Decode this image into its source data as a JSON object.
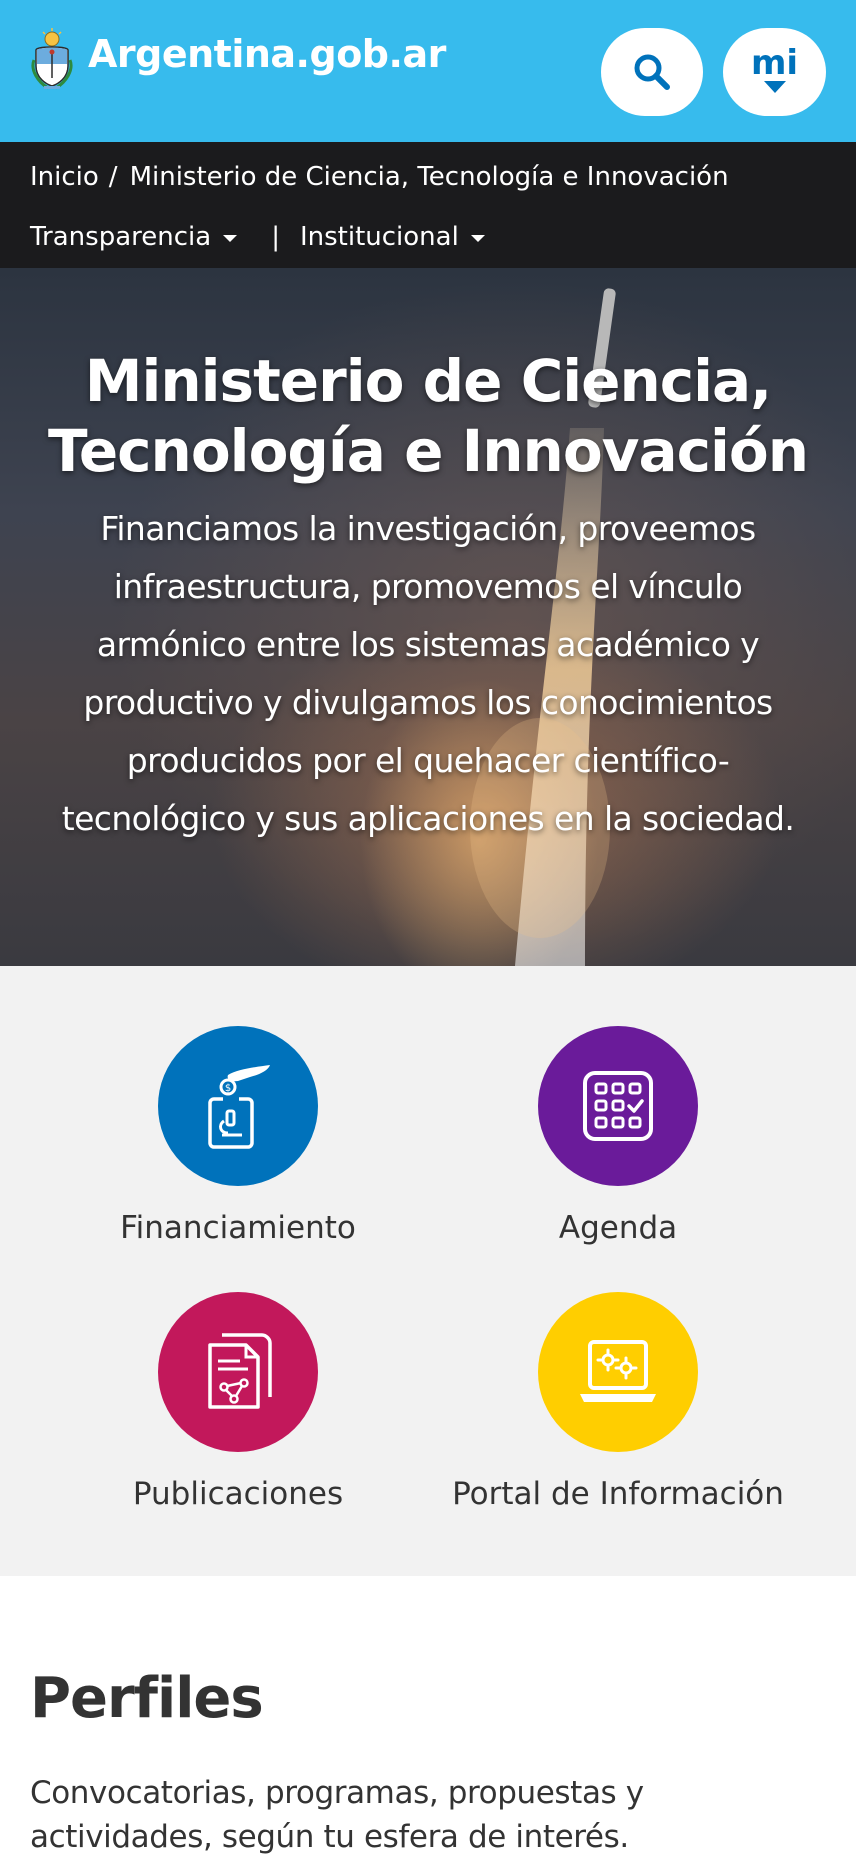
{
  "header": {
    "brand_text": "Argentina.gob.ar",
    "search_icon": "search-icon",
    "mi_label": "mi",
    "colors": {
      "bar": "#37bbed",
      "accent": "#0072bb"
    }
  },
  "breadcrumb": {
    "home": "Inicio",
    "separator": "/",
    "current": "Ministerio de Ciencia, Tecnología e Innovación"
  },
  "menus": {
    "transparencia": "Transparencia",
    "divider": "|",
    "institucional": "Institucional"
  },
  "hero": {
    "title_line1": "Ministerio de Ciencia,",
    "title_line2": "Tecnología e Innovación",
    "description": "Financiamos la investigación, proveemos infraestructura, promovemos el vínculo armónico entre los sistemas académico y productivo y divulgamos los conocimientos producidos por el quehacer científico-tecnológico y sus aplicaciones en la sociedad."
  },
  "quick_links": [
    {
      "label": "Financiamiento",
      "icon": "funding-microscope-icon",
      "color": "#0072bb"
    },
    {
      "label": "Agenda",
      "icon": "calendar-grid-icon",
      "color": "#6a1b9a"
    },
    {
      "label": "Publicaciones",
      "icon": "publications-document-icon",
      "color": "#c2185b"
    },
    {
      "label": "Portal de Información",
      "icon": "laptop-gears-icon",
      "color": "#ffce00"
    }
  ],
  "profiles": {
    "title": "Perfiles",
    "description": "Convocatorias, programas, propuestas y actividades, según tu esfera de interés."
  }
}
